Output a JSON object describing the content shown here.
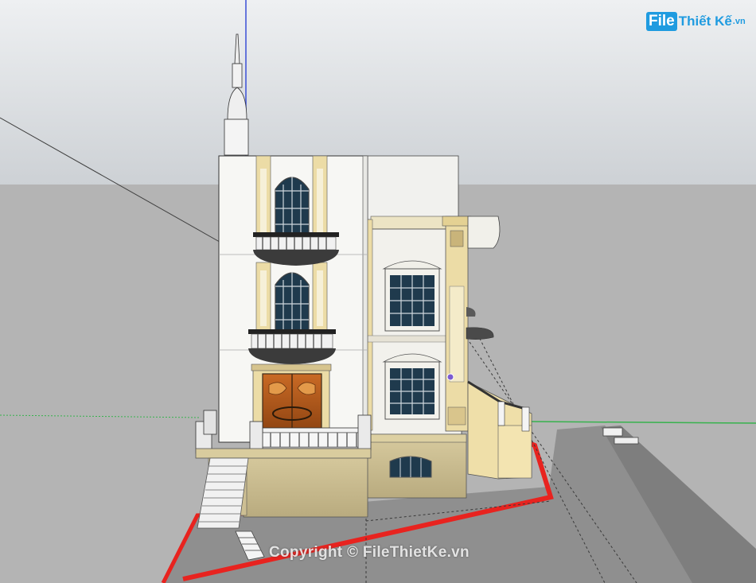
{
  "watermark": {
    "logo_file": "File",
    "logo_name": "Thiết Kế",
    "logo_domain": ".vn",
    "copyright": "Copyright © FileThietKe.vn"
  },
  "colors": {
    "sky_top": "#eef0f2",
    "sky_bottom": "#cdd1d5",
    "ground": "#b4b4b4",
    "axis_blue": "#3a4fd6",
    "axis_green": "#37b24d",
    "axis_red": "#e8231f",
    "wall_white": "#f7f7f4",
    "wall_cream": "#ecdca6",
    "base_stone": "#cdbf93",
    "window_glass": "#1f3a4d",
    "door_wood": "#b55a1d",
    "brand_blue": "#1f9be0"
  },
  "icons": {
    "axis_origin": "axis-origin-dot"
  }
}
